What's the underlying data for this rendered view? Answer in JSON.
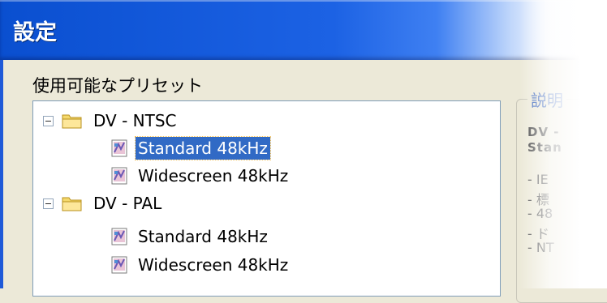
{
  "window": {
    "title": "設定"
  },
  "presets": {
    "label": "使用可能なプリセット",
    "groups": [
      {
        "name": "DV - NTSC",
        "items": [
          "Standard 48kHz",
          "Widescreen 48kHz"
        ]
      },
      {
        "name": "DV - PAL",
        "items": [
          "Standard 48kHz",
          "Widescreen 48kHz"
        ]
      }
    ],
    "selected": "DV - NTSC / Standard 48kHz"
  },
  "description": {
    "title": "説明",
    "lines_bold": [
      "DV -",
      "Stan"
    ],
    "lines": [
      "- IE",
      "- 標",
      "- 48",
      "- ド",
      "- NT"
    ]
  },
  "colors": {
    "selection": "#316ac5",
    "titlebar": "#0a4fd0",
    "panel": "#ece9d8"
  }
}
